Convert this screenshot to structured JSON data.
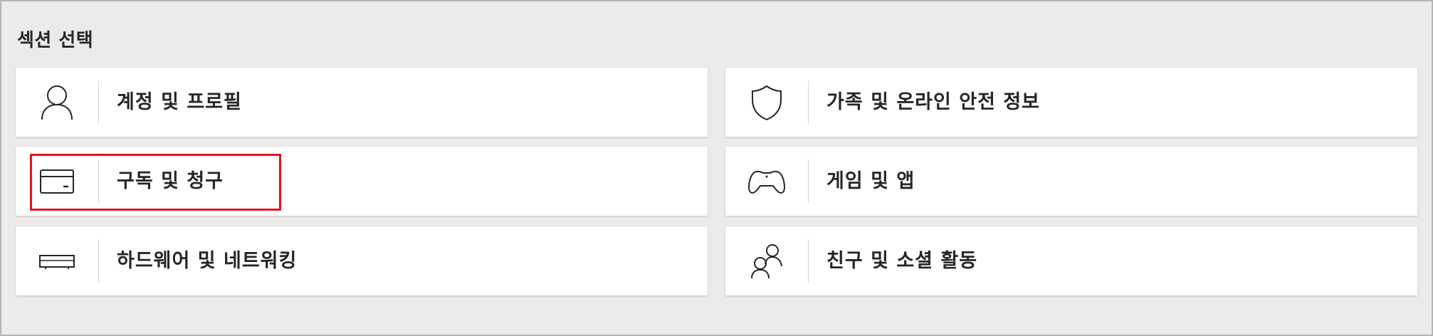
{
  "section": {
    "title": "섹션 선택"
  },
  "tiles": [
    {
      "label": "계정 및 프로필",
      "icon": "person-icon"
    },
    {
      "label": "가족 및 온라인 안전 정보",
      "icon": "shield-icon"
    },
    {
      "label": "구독 및 청구",
      "icon": "credit-card-icon"
    },
    {
      "label": "게임 및 앱",
      "icon": "game-controller-icon"
    },
    {
      "label": "하드웨어 및 네트워킹",
      "icon": "console-icon"
    },
    {
      "label": "친구 및 소셜 활동",
      "icon": "friends-icon"
    }
  ],
  "colors": {
    "background": "#edebe9",
    "tile": "#ffffff",
    "text": "#262626",
    "highlight": "#e81123"
  }
}
